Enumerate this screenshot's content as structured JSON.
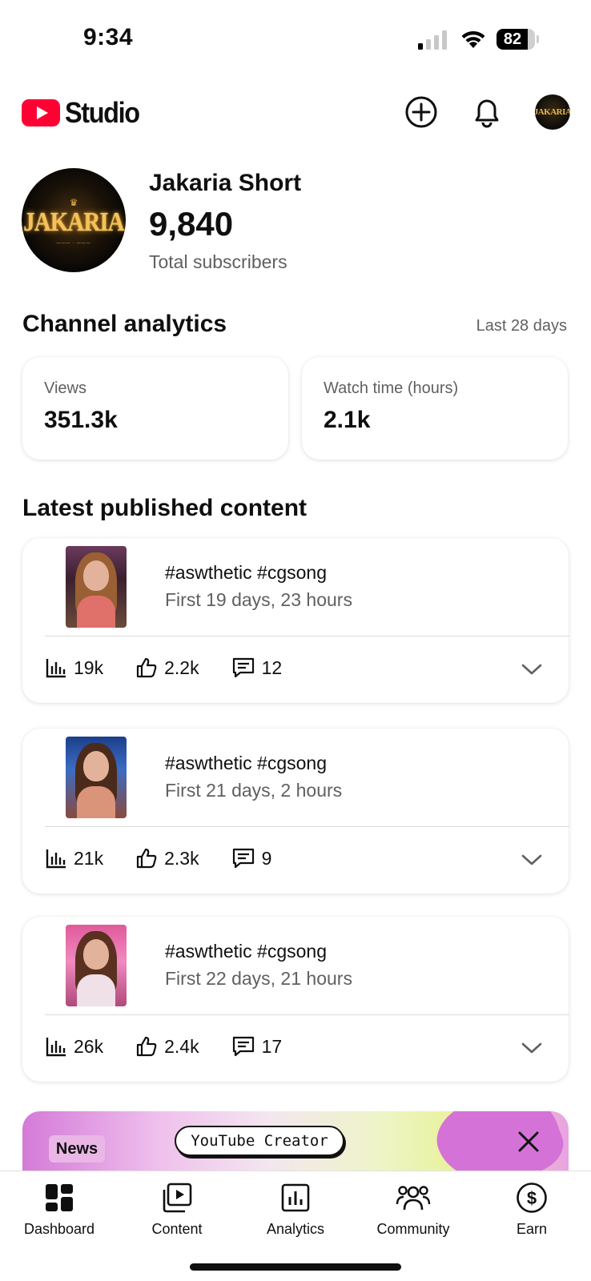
{
  "status_bar": {
    "time": "9:34",
    "battery_percent": "82",
    "battery_level": 0.82
  },
  "header": {
    "logo_text": "Studio",
    "icons": [
      "youtube-logo-icon",
      "create-icon",
      "bell-icon",
      "channel-avatar-icon"
    ]
  },
  "channel": {
    "name": "Jakaria Short",
    "subscriber_count": "9,840",
    "subscriber_label": "Total subscribers",
    "avatar_text": "JAKARIA",
    "avatar_small_text": "JAKARIA"
  },
  "analytics": {
    "title": "Channel analytics",
    "period": "Last 28 days",
    "cards": [
      {
        "label": "Views",
        "value": "351.3k"
      },
      {
        "label": "Watch time (hours)",
        "value": "2.1k"
      }
    ]
  },
  "latest": {
    "title": "Latest published content",
    "items": [
      {
        "title": "#aswthetic #cgsong",
        "subtitle": "First 19 days, 23 hours",
        "views": "19k",
        "likes": "2.2k",
        "comments": "12"
      },
      {
        "title": "#aswthetic #cgsong",
        "subtitle": "First 21 days, 2 hours",
        "views": "21k",
        "likes": "2.3k",
        "comments": "9"
      },
      {
        "title": "#aswthetic #cgsong",
        "subtitle": "First 22 days, 21 hours",
        "views": "26k",
        "likes": "2.4k",
        "comments": "17"
      }
    ]
  },
  "banner": {
    "tag": "News",
    "pill_text": "YouTube Creator"
  },
  "bottom_nav": {
    "items": [
      {
        "label": "Dashboard",
        "icon": "dashboard-icon"
      },
      {
        "label": "Content",
        "icon": "content-icon"
      },
      {
        "label": "Analytics",
        "icon": "analytics-icon"
      },
      {
        "label": "Community",
        "icon": "community-icon"
      },
      {
        "label": "Earn",
        "icon": "earn-icon"
      }
    ]
  },
  "colors": {
    "youtube_red": "#ff0033",
    "text_primary": "#0f0f0f",
    "text_secondary": "#606060"
  }
}
